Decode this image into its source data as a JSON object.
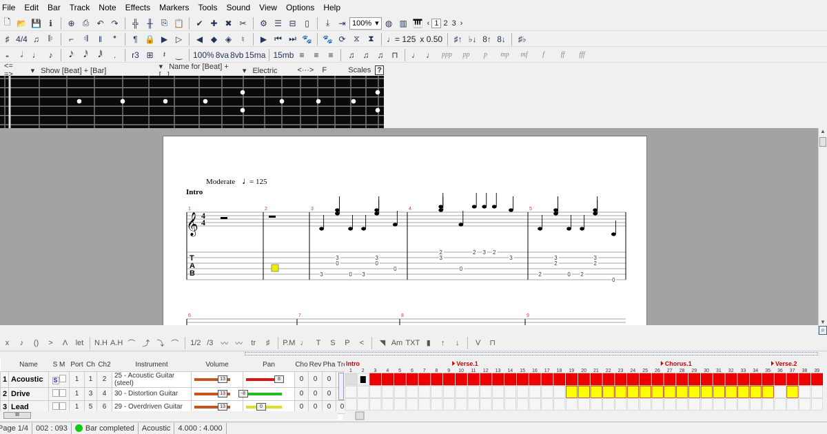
{
  "menu": [
    "File",
    "Edit",
    "Bar",
    "Track",
    "Note",
    "Effects",
    "Markers",
    "Tools",
    "Sound",
    "View",
    "Options",
    "Help"
  ],
  "toolbar1": {
    "icons": [
      [
        "new-file-icon",
        "🗋"
      ],
      [
        "open-folder-icon",
        "📂"
      ],
      [
        "save-icon",
        "💾"
      ],
      [
        "info-icon",
        "ℹ"
      ],
      [
        "page-setup-icon",
        "⊕"
      ],
      [
        "print-icon",
        "⎙"
      ],
      [
        "undo-icon",
        "↶"
      ],
      [
        "redo-icon",
        "↷"
      ],
      [
        "insert-bar-icon",
        "╬"
      ],
      [
        "remove-bar-icon",
        "╫"
      ],
      [
        "copy-icon",
        "⎘"
      ],
      [
        "paste-icon",
        "📋"
      ],
      [
        "check-icon",
        "✔"
      ],
      [
        "add-track-icon",
        "✚"
      ],
      [
        "delete-track-icon",
        "✖"
      ],
      [
        "cut-icon",
        "✂"
      ],
      [
        "settings-icon",
        "⚙"
      ],
      [
        "page-view-icon",
        "☰"
      ],
      [
        "screen-view-icon",
        "⊟"
      ],
      [
        "parchment-view-icon",
        "▯"
      ],
      [
        "go-down-icon",
        "⤓"
      ],
      [
        "go-right-icon",
        "⇥"
      ]
    ],
    "zoom": "100%",
    "after": [
      [
        "speaker-icon",
        "◍"
      ],
      [
        "fretboard-icon",
        "▥"
      ],
      [
        "piano-icon",
        "🎹"
      ]
    ],
    "pages": [
      "1",
      "2",
      "3"
    ]
  },
  "toolbar2": {
    "icons": [
      [
        "key-signature-icon",
        "♯"
      ],
      [
        "time-signature-icon",
        "4/4"
      ],
      [
        "triplet-feel-icon",
        "♫"
      ],
      [
        "repeat-open-icon",
        "𝄆"
      ],
      [
        "alternate-ending-icon",
        "⌐"
      ],
      [
        "repeat-close-icon",
        "𝄇"
      ],
      [
        "double-bar-icon",
        "‖"
      ],
      [
        "direction-icon",
        "𝄌"
      ],
      [
        "paragraph-icon",
        "¶"
      ],
      [
        "lock-icon",
        "🔒"
      ],
      [
        "marker-add-icon",
        "▶"
      ],
      [
        "marker-list-icon",
        "▷"
      ],
      [
        "marker-prev-icon",
        "◀"
      ],
      [
        "marker-next-icon",
        "◆"
      ],
      [
        "marker-goto-icon",
        "◈"
      ],
      [
        "tuner-icon",
        "♮"
      ],
      [
        "play-icon",
        "▶"
      ],
      [
        "first-bar-icon",
        "⏮"
      ],
      [
        "last-bar-icon",
        "⏭"
      ],
      [
        "paw-icon",
        "🐾"
      ],
      [
        "paw2-icon",
        "🐾"
      ],
      [
        "loop-icon",
        "⟳"
      ],
      [
        "metronome-icon",
        "⧖"
      ],
      [
        "count-in-icon",
        "⧗"
      ]
    ],
    "tempo": "♩= 125",
    "speed": "x 0.50",
    "after": [
      [
        "sharp-up-icon",
        "♯↑"
      ],
      [
        "flat-down-icon",
        "♭↓"
      ],
      [
        "octave-up-icon",
        "8↑"
      ],
      [
        "octave-down-icon",
        "8↓"
      ],
      [
        "enharmonic-icon",
        "♯♭"
      ]
    ]
  },
  "toolbar3": {
    "icons": [
      [
        "whole-note-icon",
        "𝅝"
      ],
      [
        "half-note-icon",
        "𝅗𝅥"
      ],
      [
        "quarter-note-icon",
        "♩"
      ],
      [
        "eighth-note-icon",
        "♪"
      ],
      [
        "sixteenth-note-icon",
        "𝅘𝅥𝅯"
      ],
      [
        "thirtysecond-note-icon",
        "𝅘𝅥𝅰"
      ],
      [
        "sixtyfourth-note-icon",
        "𝅘𝅥𝅱"
      ],
      [
        "dotted-icon",
        "."
      ],
      [
        "tuplet-icon",
        "r3"
      ],
      [
        "chord-icon",
        "⊞"
      ],
      [
        "rest-icon",
        "𝄽"
      ],
      [
        "tie-icon",
        "‿"
      ],
      [
        "velocity-icon",
        "100%"
      ],
      [
        "8va-icon",
        "8va"
      ],
      [
        "8vb-icon",
        "8vb"
      ],
      [
        "15ma-icon",
        "15ma"
      ],
      [
        "15mb-icon",
        "15mb"
      ],
      [
        "voice-1-icon",
        "≡"
      ],
      [
        "voice-2-icon",
        "≡"
      ],
      [
        "voice-3-icon",
        "≡"
      ],
      [
        "beam-auto-icon",
        "♫"
      ],
      [
        "beam-icon",
        "♫"
      ],
      [
        "beam-break-icon",
        "♫"
      ],
      [
        "tab-rhythm-icon",
        "⊓"
      ],
      [
        "stem-auto-icon",
        "♩"
      ],
      [
        "stem-icon",
        "♩"
      ]
    ],
    "dynamics": [
      "ppp",
      "pp",
      "p",
      "mp",
      "mf",
      "f",
      "ff",
      "fff"
    ]
  },
  "fretboard_bar": {
    "nav": "<=  =>",
    "show": "Show [Beat] + [Bar]",
    "name_for": "Name for [Beat] + [...]",
    "type": "Electric",
    "arrows": "<···>",
    "key": "F",
    "scales": "Scales",
    "help": "?"
  },
  "score": {
    "tempo_label": "Moderate",
    "tempo_note": "♩",
    "tempo_value": "= 125",
    "section": "Intro",
    "clef": "𝄞",
    "time_sig_top": "4",
    "time_sig_bottom": "4",
    "tab_label": [
      "T",
      "A",
      "B"
    ],
    "bars": [
      {
        "n": "1"
      },
      {
        "n": "2"
      },
      {
        "n": "3"
      },
      {
        "n": "4"
      },
      {
        "n": "5"
      }
    ],
    "second_system_bars": [
      "6",
      "7",
      "8",
      "9"
    ],
    "tab_notes": [
      {
        "bar": 3,
        "pos": 1,
        "string": 5,
        "fret": "3"
      },
      {
        "bar": 3,
        "pos": 4,
        "string": 2,
        "fret": "3"
      },
      {
        "bar": 3,
        "pos": 4,
        "string": 3,
        "fret": "0"
      },
      {
        "bar": 3,
        "pos": 6.5,
        "string": 5,
        "fret": "0"
      },
      {
        "bar": 3,
        "pos": 9,
        "string": 5,
        "fret": "3"
      },
      {
        "bar": 3,
        "pos": 11.5,
        "string": 2,
        "fret": "3"
      },
      {
        "bar": 3,
        "pos": 11.5,
        "string": 3,
        "fret": "0"
      },
      {
        "bar": 3,
        "pos": 15,
        "string": 4,
        "fret": "0"
      },
      {
        "bar": 4,
        "pos": 4,
        "string": 1,
        "fret": "2"
      },
      {
        "bar": 4,
        "pos": 4,
        "string": 2,
        "fret": "3"
      },
      {
        "bar": 4,
        "pos": 7,
        "string": 4,
        "fret": "0"
      },
      {
        "bar": 4,
        "pos": 9,
        "string": 1,
        "fret": "2"
      },
      {
        "bar": 4,
        "pos": 10.5,
        "string": 1,
        "fret": "3"
      },
      {
        "bar": 4,
        "pos": 12,
        "string": 1,
        "fret": "2"
      },
      {
        "bar": 4,
        "pos": 14.5,
        "string": 2,
        "fret": "3"
      },
      {
        "bar": 5,
        "pos": 1,
        "string": 5,
        "fret": "2"
      },
      {
        "bar": 5,
        "pos": 4,
        "string": 2,
        "fret": "3"
      },
      {
        "bar": 5,
        "pos": 4,
        "string": 3,
        "fret": "2"
      },
      {
        "bar": 5,
        "pos": 6.5,
        "string": 5,
        "fret": "0"
      },
      {
        "bar": 5,
        "pos": 9,
        "string": 5,
        "fret": "2"
      },
      {
        "bar": 5,
        "pos": 11.5,
        "string": 2,
        "fret": "3"
      },
      {
        "bar": 5,
        "pos": 11.5,
        "string": 3,
        "fret": "2"
      },
      {
        "bar": 5,
        "pos": 15,
        "string": 6,
        "fret": "0"
      }
    ]
  },
  "fx_toolbar": [
    [
      "dead-note-icon",
      "x"
    ],
    [
      "grace-note-icon",
      "♪"
    ],
    [
      "ghost-note-icon",
      "()"
    ],
    [
      "accent-icon",
      ">"
    ],
    [
      "heavy-accent-icon",
      "Λ"
    ],
    [
      "let-ring-icon",
      "let"
    ],
    [
      "natural-harmonic-icon",
      "N.H"
    ],
    [
      "artificial-harmonic-icon",
      "A.H"
    ],
    [
      "vibrato-bend-icon",
      "⌒"
    ],
    [
      "bend-icon",
      "⤴"
    ],
    [
      "slide-icon",
      "⤵"
    ],
    [
      "hammer-icon",
      "⌒"
    ],
    [
      "tap-icon",
      "1/2"
    ],
    [
      "slap-icon",
      "/3"
    ],
    [
      "vibrato-icon",
      "〰"
    ],
    [
      "wide-vibrato-icon",
      "〰"
    ],
    [
      "trill-icon",
      "tr"
    ],
    [
      "tremolo-icon",
      "♯"
    ],
    [
      "palm-mute-icon",
      "P.M"
    ],
    [
      "staccato-icon",
      "♩"
    ],
    [
      "tap-t-icon",
      "T"
    ],
    [
      "slap-s-icon",
      "S"
    ],
    [
      "pop-p-icon",
      "P"
    ],
    [
      "crescendo-icon",
      "<"
    ],
    [
      "fade-icon",
      "◥"
    ],
    [
      "chord-diagram-icon",
      "Am"
    ],
    [
      "text-icon",
      "TXT"
    ],
    [
      "mix-table-icon",
      "▮"
    ],
    [
      "pickstroke-up-icon",
      "↑"
    ],
    [
      "pickstroke-down-icon",
      "↓"
    ],
    [
      "upstroke-icon",
      "V"
    ],
    [
      "downstroke-icon",
      "⊓"
    ]
  ],
  "tracks": {
    "headers": [
      "",
      "Name",
      "S M",
      "Port",
      "Ch",
      "Ch2",
      "Instrument",
      "Volume",
      "Pan",
      "Cho",
      "Rev",
      "Pha",
      "Tre"
    ],
    "rows": [
      {
        "num": "1",
        "name": "Acoustic",
        "solo": "S",
        "port": "1",
        "ch": "1",
        "ch2": "2",
        "instrument": "25 - Acoustic Guitar (steel)",
        "volume": "13",
        "pan": "8",
        "pan_color": "#dd1111",
        "cho": "0",
        "rev": "0",
        "pha": "0",
        "tre": "0",
        "volume_level": 13,
        "pan_level": 8
      },
      {
        "num": "2",
        "name": "Drive",
        "solo": "",
        "port": "1",
        "ch": "3",
        "ch2": "4",
        "instrument": "30 - Distortion Guitar",
        "volume": "13",
        "pan": "-8",
        "pan_color": "#22bb22",
        "cho": "0",
        "rev": "0",
        "pha": "0",
        "tre": "0",
        "volume_level": 13,
        "pan_level": -8
      },
      {
        "num": "3",
        "name": "Lead",
        "solo": "",
        "port": "1",
        "ch": "5",
        "ch2": "6",
        "instrument": "29 - Overdriven Guitar",
        "volume": "13",
        "pan": "0",
        "pan_color": "#dddd22",
        "cho": "0",
        "rev": "0",
        "pha": "0",
        "tre": "0",
        "volume_level": 13,
        "pan_level": 0
      }
    ]
  },
  "timeline": {
    "markers": [
      {
        "bar": 1,
        "label": "Intro"
      },
      {
        "bar": 10,
        "label": "Verse.1"
      },
      {
        "bar": 27,
        "label": "Chorus.1"
      },
      {
        "bar": 36,
        "label": "Verse.2"
      }
    ],
    "bar_count": 39,
    "marker_color": "#cc0000",
    "track_fill": [
      {
        "color": "#ee0000",
        "bars": [
          3,
          4,
          5,
          6,
          7,
          8,
          9,
          10,
          11,
          12,
          13,
          14,
          15,
          16,
          17,
          18,
          19,
          20,
          21,
          22,
          23,
          24,
          25,
          26,
          27,
          28,
          29,
          30,
          31,
          32,
          33,
          34,
          35,
          36,
          37,
          38,
          39
        ],
        "selected_bar": 2
      },
      {
        "color": "#ffff00",
        "bars": [
          19,
          20,
          21,
          22,
          23,
          24,
          25,
          26,
          27,
          28,
          29,
          30,
          31,
          32,
          33,
          34,
          35,
          37
        ]
      },
      {
        "color": "#ffffff",
        "bars": []
      }
    ]
  },
  "status": {
    "page": "Page 1/4",
    "position": "002 : 093",
    "state": "Bar completed",
    "track": "Acoustic",
    "time": "4.000 : 4.000"
  }
}
